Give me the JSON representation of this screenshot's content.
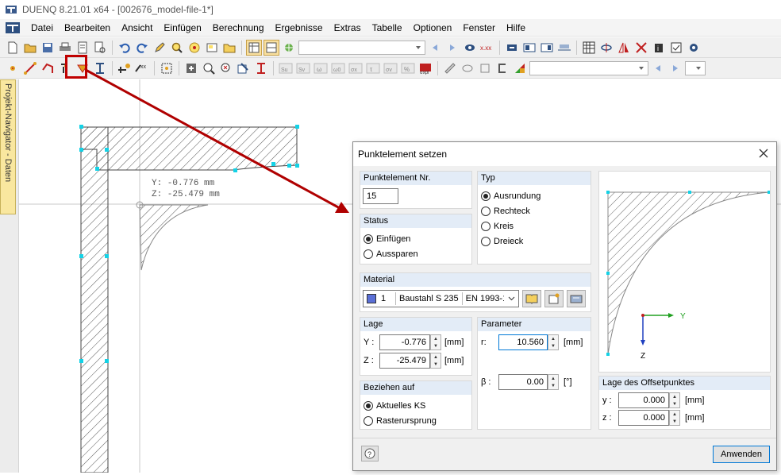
{
  "window": {
    "title": "DUENQ 8.21.01 x64 - [002676_model-file-1*]"
  },
  "menu": [
    "Datei",
    "Bearbeiten",
    "Ansicht",
    "Einfügen",
    "Berechnung",
    "Ergebnisse",
    "Extras",
    "Tabelle",
    "Optionen",
    "Fenster",
    "Hilfe"
  ],
  "side_tab": {
    "label": "Projekt-Navigator - Daten"
  },
  "canvas": {
    "coord_y": "Y:  -0.776 mm",
    "coord_z": "Z: -25.479 mm"
  },
  "dialog": {
    "title": "Punktelement setzen",
    "element_nr": {
      "header": "Punktelement Nr.",
      "value": "15"
    },
    "typ": {
      "header": "Typ",
      "options": [
        "Ausrundung",
        "Rechteck",
        "Kreis",
        "Dreieck"
      ],
      "selected": "Ausrundung"
    },
    "status": {
      "header": "Status",
      "options": [
        "Einfügen",
        "Aussparen"
      ],
      "selected": "Einfügen"
    },
    "material": {
      "header": "Material",
      "number": "1",
      "name": "Baustahl S 235",
      "norm": "EN 1993-1-",
      "swatch_color": "#5a6fd6"
    },
    "lage": {
      "header": "Lage",
      "y_label": "Y :",
      "y_value": "-0.776",
      "z_label": "Z :",
      "z_value": "-25.479",
      "unit": "[mm]"
    },
    "parameter": {
      "header": "Parameter",
      "r_label": "r:",
      "r_value": "10.560",
      "r_unit": "[mm]",
      "beta_label": "β :",
      "beta_value": "0.00",
      "beta_unit": "[°]"
    },
    "beziehen": {
      "header": "Beziehen auf",
      "options": [
        "Aktuelles KS",
        "Rasterursprung"
      ],
      "selected": "Aktuelles KS"
    },
    "preview": {
      "axis_y": "Y",
      "axis_z": "Z"
    },
    "offset": {
      "header": "Lage des Offsetpunktes",
      "y_label": "y :",
      "y_value": "0.000",
      "z_label": "z :",
      "z_value": "0.000",
      "unit": "[mm]"
    },
    "apply_label": "Anwenden"
  },
  "colors": {
    "highlight": "#c00000",
    "selection_handle": "#14d2e6",
    "group_header": "#e3ecf7"
  }
}
